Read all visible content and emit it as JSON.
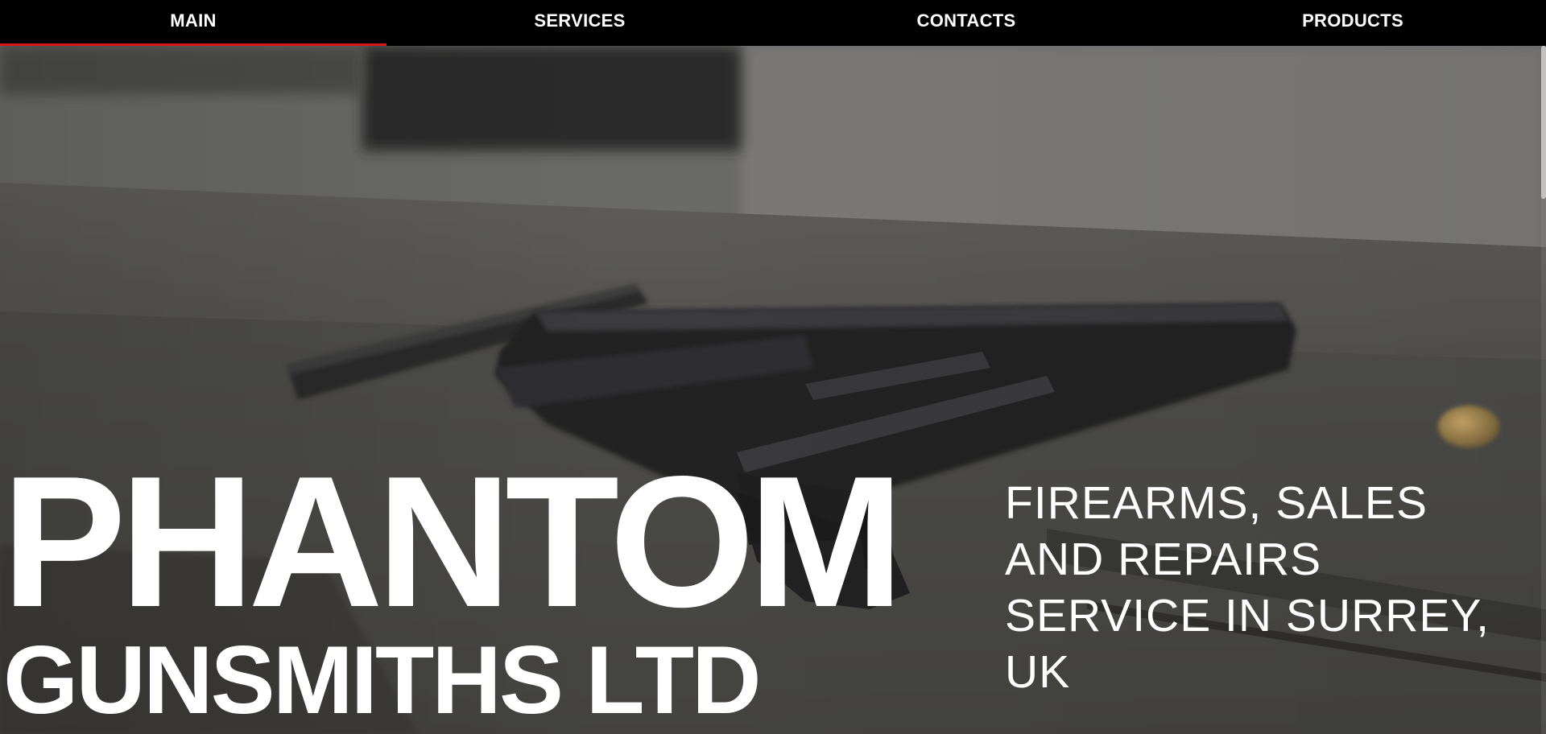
{
  "nav": {
    "items": [
      {
        "label": "MAIN",
        "active": true
      },
      {
        "label": "SERVICES",
        "active": false
      },
      {
        "label": "CONTACTS",
        "active": false
      },
      {
        "label": "PRODUCTS",
        "active": false
      }
    ],
    "active_underline_color": "#d91616"
  },
  "hero": {
    "title_line1": "PHANTOM",
    "title_line2": "GUNSMITHS LTD",
    "tagline": "FIREARMS, SALES AND REPAIRS SERVICE IN SURREY, UK",
    "background_image": "handgun-on-wooden-table-photo"
  }
}
